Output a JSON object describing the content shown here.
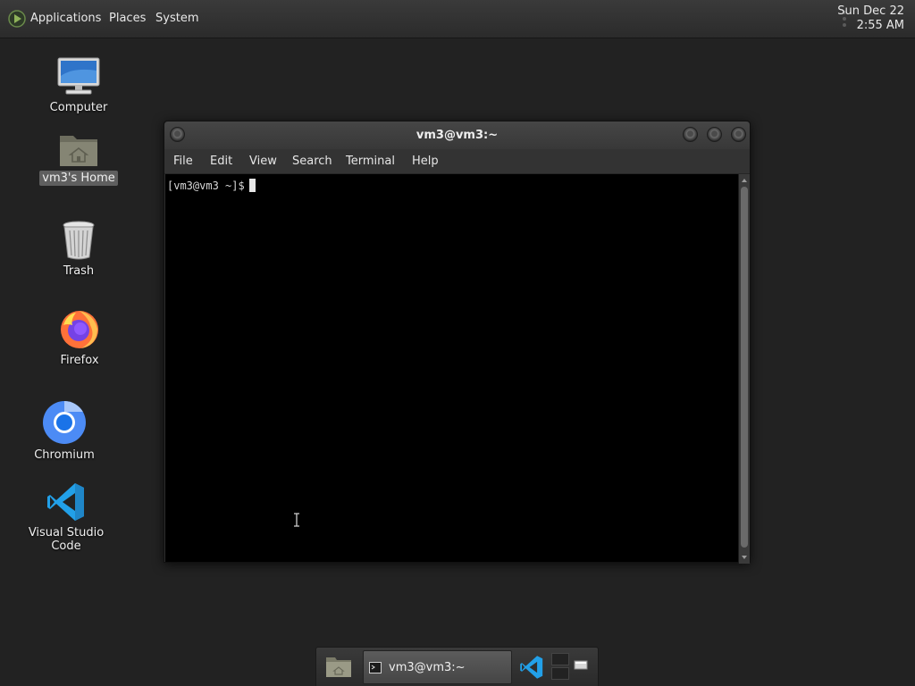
{
  "top_panel": {
    "menus": [
      "Applications",
      "Places",
      "System"
    ],
    "clock": {
      "date": "Sun Dec 22",
      "time": "2:55 AM"
    }
  },
  "desktop": {
    "icons": [
      {
        "label": "Computer",
        "icon": "computer-icon"
      },
      {
        "label": "vm3's Home",
        "icon": "home-folder-icon",
        "selected": true
      },
      {
        "label": "Trash",
        "icon": "trash-icon"
      },
      {
        "label": "Firefox",
        "icon": "firefox-icon"
      },
      {
        "label": "Chromium",
        "icon": "chromium-icon"
      },
      {
        "label": "Visual Studio Code",
        "icon": "vscode-icon"
      }
    ]
  },
  "window": {
    "title": "vm3@vm3:~",
    "menus": [
      "File",
      "Edit",
      "View",
      "Search",
      "Terminal",
      "Help"
    ],
    "prompt": "[vm3@vm3 ~]$"
  },
  "taskbar": {
    "active_task": "vm3@vm3:~",
    "icons": [
      "files-icon",
      "terminal-icon",
      "vscode-icon"
    ]
  },
  "colors": {
    "desktop_bg": "#222222",
    "panel_bg": "#333333",
    "terminal_bg": "#000000",
    "vscode_blue": "#22a0e8",
    "firefox_orange": "#ff7139"
  }
}
